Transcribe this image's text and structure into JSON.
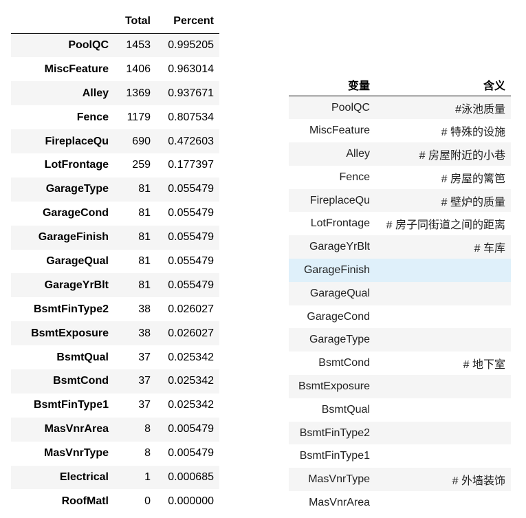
{
  "left_table": {
    "headers": {
      "index": "",
      "total": "Total",
      "percent": "Percent"
    },
    "rows": [
      {
        "name": "PoolQC",
        "total": "1453",
        "percent": "0.995205"
      },
      {
        "name": "MiscFeature",
        "total": "1406",
        "percent": "0.963014"
      },
      {
        "name": "Alley",
        "total": "1369",
        "percent": "0.937671"
      },
      {
        "name": "Fence",
        "total": "1179",
        "percent": "0.807534"
      },
      {
        "name": "FireplaceQu",
        "total": "690",
        "percent": "0.472603"
      },
      {
        "name": "LotFrontage",
        "total": "259",
        "percent": "0.177397"
      },
      {
        "name": "GarageType",
        "total": "81",
        "percent": "0.055479"
      },
      {
        "name": "GarageCond",
        "total": "81",
        "percent": "0.055479"
      },
      {
        "name": "GarageFinish",
        "total": "81",
        "percent": "0.055479"
      },
      {
        "name": "GarageQual",
        "total": "81",
        "percent": "0.055479"
      },
      {
        "name": "GarageYrBlt",
        "total": "81",
        "percent": "0.055479"
      },
      {
        "name": "BsmtFinType2",
        "total": "38",
        "percent": "0.026027"
      },
      {
        "name": "BsmtExposure",
        "total": "38",
        "percent": "0.026027"
      },
      {
        "name": "BsmtQual",
        "total": "37",
        "percent": "0.025342"
      },
      {
        "name": "BsmtCond",
        "total": "37",
        "percent": "0.025342"
      },
      {
        "name": "BsmtFinType1",
        "total": "37",
        "percent": "0.025342"
      },
      {
        "name": "MasVnrArea",
        "total": "8",
        "percent": "0.005479"
      },
      {
        "name": "MasVnrType",
        "total": "8",
        "percent": "0.005479"
      },
      {
        "name": "Electrical",
        "total": "1",
        "percent": "0.000685"
      },
      {
        "name": "RoofMatl",
        "total": "0",
        "percent": "0.000000"
      }
    ]
  },
  "right_table": {
    "headers": {
      "variable": "变量",
      "meaning": "含义"
    },
    "highlight_color": "#dff0fa",
    "rows": [
      {
        "variable": "PoolQC",
        "meaning": "#泳池质量"
      },
      {
        "variable": "MiscFeature",
        "meaning": "# 特殊的设施"
      },
      {
        "variable": "Alley",
        "meaning": "# 房屋附近的小巷"
      },
      {
        "variable": "Fence",
        "meaning": "# 房屋的篱笆"
      },
      {
        "variable": "FireplaceQu",
        "meaning": "# 壁炉的质量"
      },
      {
        "variable": "LotFrontage",
        "meaning": "# 房子同街道之间的距离"
      },
      {
        "variable": "GarageYrBlt",
        "meaning": "# 车库"
      },
      {
        "variable": "GarageFinish",
        "meaning": "",
        "highlighted": true
      },
      {
        "variable": "GarageQual",
        "meaning": ""
      },
      {
        "variable": "GarageCond",
        "meaning": ""
      },
      {
        "variable": "GarageType",
        "meaning": ""
      },
      {
        "variable": "BsmtCond",
        "meaning": "# 地下室"
      },
      {
        "variable": "BsmtExposure",
        "meaning": ""
      },
      {
        "variable": "BsmtQual",
        "meaning": ""
      },
      {
        "variable": "BsmtFinType2",
        "meaning": ""
      },
      {
        "variable": "BsmtFinType1",
        "meaning": ""
      },
      {
        "variable": "MasVnrType",
        "meaning": "# 外墙装饰"
      },
      {
        "variable": "MasVnrArea",
        "meaning": ""
      }
    ]
  }
}
